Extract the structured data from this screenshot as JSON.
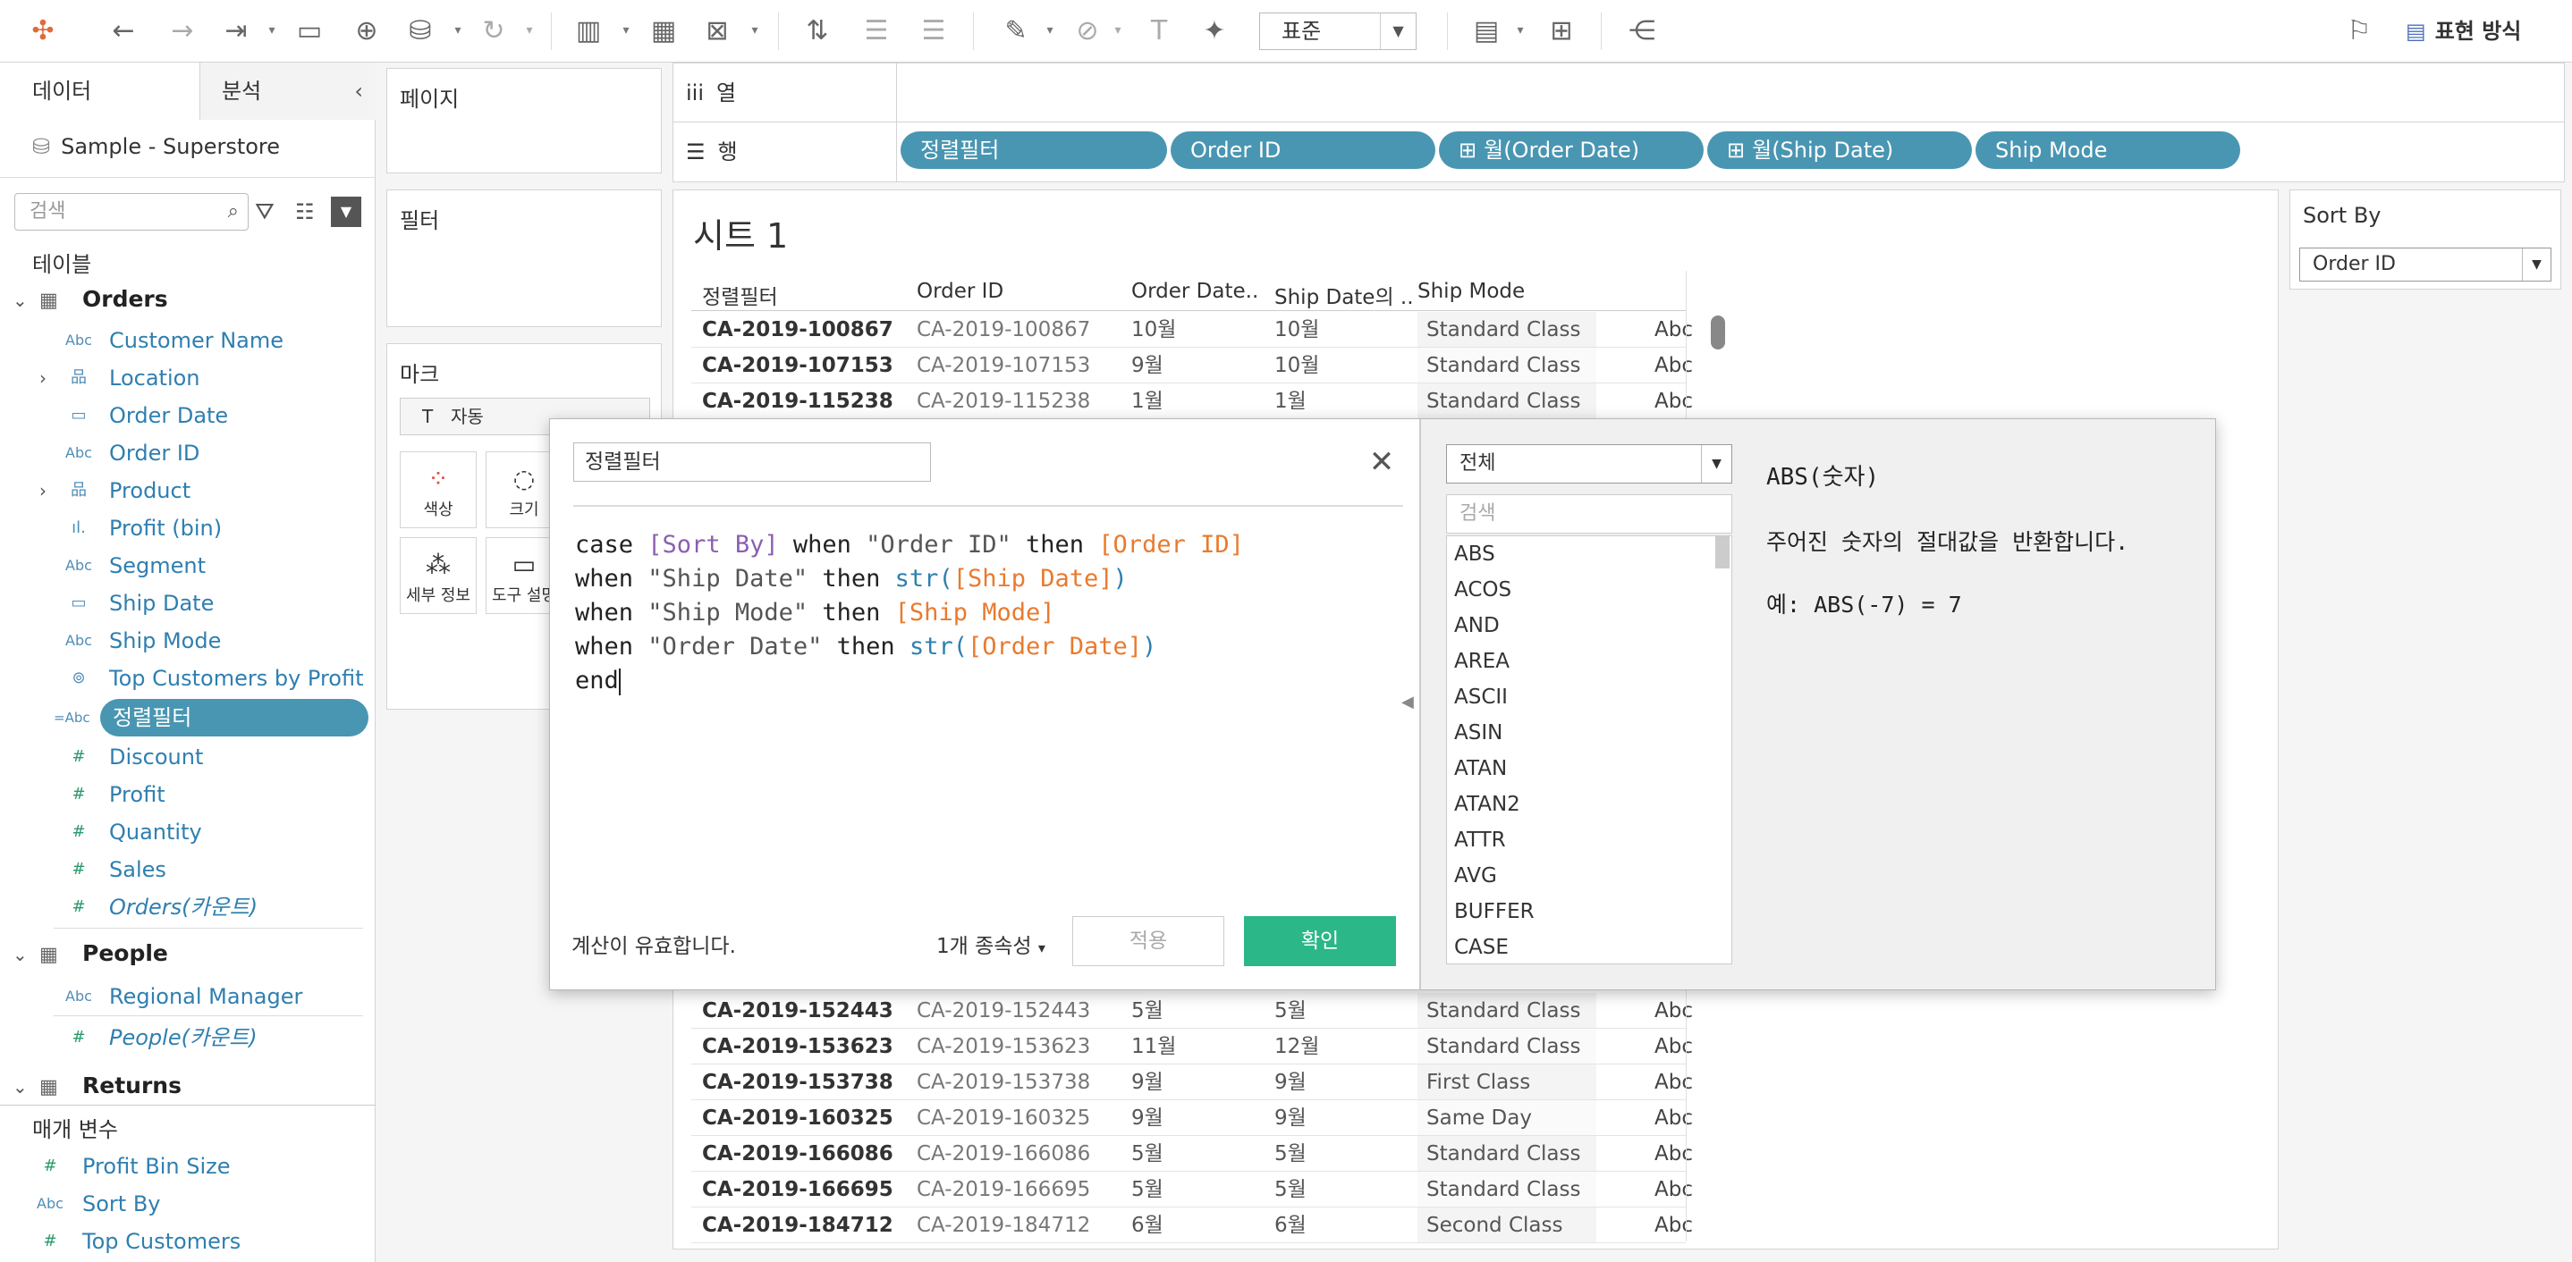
{
  "toolbar": {
    "view_size": "표준",
    "show_me": "표현 방식"
  },
  "left": {
    "tab_data": "데이터",
    "tab_analysis": "분석",
    "datasource": "Sample - Superstore",
    "search_placeholder": "검색",
    "tables_label": "테이블",
    "orders": {
      "name": "Orders",
      "fields": [
        "Customer Name",
        "Location",
        "Order Date",
        "Order ID",
        "Product",
        "Profit (bin)",
        "Segment",
        "Ship Date",
        "Ship Mode",
        "Top Customers by Profit",
        "정렬필터"
      ],
      "measures": [
        "Discount",
        "Profit",
        "Quantity",
        "Sales",
        "Orders(카운트)"
      ]
    },
    "people": {
      "name": "People",
      "fields": [
        "Regional Manager"
      ],
      "measures": [
        "People(카운트)"
      ]
    },
    "returns": {
      "name": "Returns"
    },
    "params_label": "매개 변수",
    "params": [
      "Profit Bin Size",
      "Sort By",
      "Top Customers"
    ]
  },
  "cards": {
    "pages": "페이지",
    "filters": "필터",
    "marks": "마크",
    "marks_type": "자동",
    "color": "색상",
    "size": "크기",
    "detail": "세부 정보",
    "tooltip": "도구 설명"
  },
  "shelves": {
    "columns": "열",
    "rows": "행",
    "row_pills": [
      "정렬필터",
      "Order ID",
      "월(Order Date)",
      "월(Ship Date)",
      "Ship Mode"
    ]
  },
  "sheet": {
    "title": "시트 1",
    "headers": [
      "정렬필터",
      "Order ID",
      "Order Date..",
      "Ship Date의 ..",
      "Ship Mode"
    ],
    "rows_top": [
      [
        "CA-2019-100867",
        "CA-2019-100867",
        "10월",
        "10월",
        "Standard Class",
        "Abc"
      ],
      [
        "CA-2019-107153",
        "CA-2019-107153",
        "9월",
        "10월",
        "Standard Class",
        "Abc"
      ],
      [
        "CA-2019-115238",
        "CA-2019-115238",
        "1월",
        "1월",
        "Standard Class",
        "Abc"
      ]
    ],
    "rows_bottom": [
      [
        "CA-2019-152443",
        "CA-2019-152443",
        "5월",
        "5월",
        "Standard Class",
        "Abc"
      ],
      [
        "CA-2019-153623",
        "CA-2019-153623",
        "11월",
        "12월",
        "Standard Class",
        "Abc"
      ],
      [
        "CA-2019-153738",
        "CA-2019-153738",
        "9월",
        "9월",
        "First Class",
        "Abc"
      ],
      [
        "CA-2019-160325",
        "CA-2019-160325",
        "9월",
        "9월",
        "Same Day",
        "Abc"
      ],
      [
        "CA-2019-166086",
        "CA-2019-166086",
        "5월",
        "5월",
        "Standard Class",
        "Abc"
      ],
      [
        "CA-2019-166695",
        "CA-2019-166695",
        "5월",
        "5월",
        "Standard Class",
        "Abc"
      ],
      [
        "CA-2019-184712",
        "CA-2019-184712",
        "6월",
        "6월",
        "Second Class",
        "Abc"
      ]
    ]
  },
  "param": {
    "title": "Sort By",
    "value": "Order ID"
  },
  "dialog": {
    "calc_name": "정렬필터",
    "status": "계산이 유효합니다.",
    "dependencies": "1개 종속성",
    "apply": "적용",
    "ok": "확인",
    "category": "전체",
    "fn_search_placeholder": "검색",
    "functions": [
      "ABS",
      "ACOS",
      "AND",
      "AREA",
      "ASCII",
      "ASIN",
      "ATAN",
      "ATAN2",
      "ATTR",
      "AVG",
      "BUFFER",
      "CASE"
    ],
    "help_title": "ABS(숫자)",
    "help_desc": "주어진 숫자의 절대값을 반환합니다.",
    "help_example": "예: ABS(-7) = 7",
    "code": {
      "l1": [
        "case",
        "[Sort By]",
        "when",
        "\"Order ID\"",
        "then",
        "[Order ID]"
      ],
      "l2": [
        "when",
        "\"Ship Date\"",
        "then",
        "str(",
        "[Ship Date]",
        ")"
      ],
      "l3": [
        "when",
        "\"Ship Mode\"",
        "then",
        "[Ship Mode]"
      ],
      "l4": [
        "when",
        "\"Order Date\"",
        "then",
        "str(",
        "[Order Date]",
        ")"
      ],
      "l5": "end"
    }
  }
}
